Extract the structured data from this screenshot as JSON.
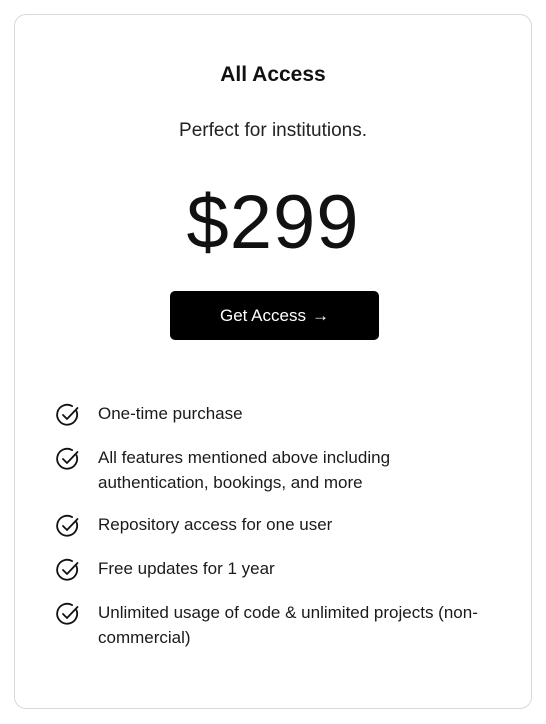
{
  "card": {
    "title": "All Access",
    "tagline": "Perfect for institutions.",
    "price": "$299",
    "cta": {
      "label": "Get Access",
      "arrow": "→"
    },
    "features": [
      {
        "icon": "check-circle-icon",
        "text": "One-time purchase"
      },
      {
        "icon": "check-circle-icon",
        "text": "All features mentioned above including authentication, bookings, and more"
      },
      {
        "icon": "check-circle-icon",
        "text": "Repository access for one user"
      },
      {
        "icon": "check-circle-icon",
        "text": "Free updates for 1 year"
      },
      {
        "icon": "check-circle-icon",
        "text": "Unlimited usage of code & unlimited projects (non-commercial)"
      }
    ]
  },
  "colors": {
    "cta_background": "#000000",
    "cta_text": "#ffffff",
    "border": "#d9d9d9",
    "text": "#111111"
  }
}
